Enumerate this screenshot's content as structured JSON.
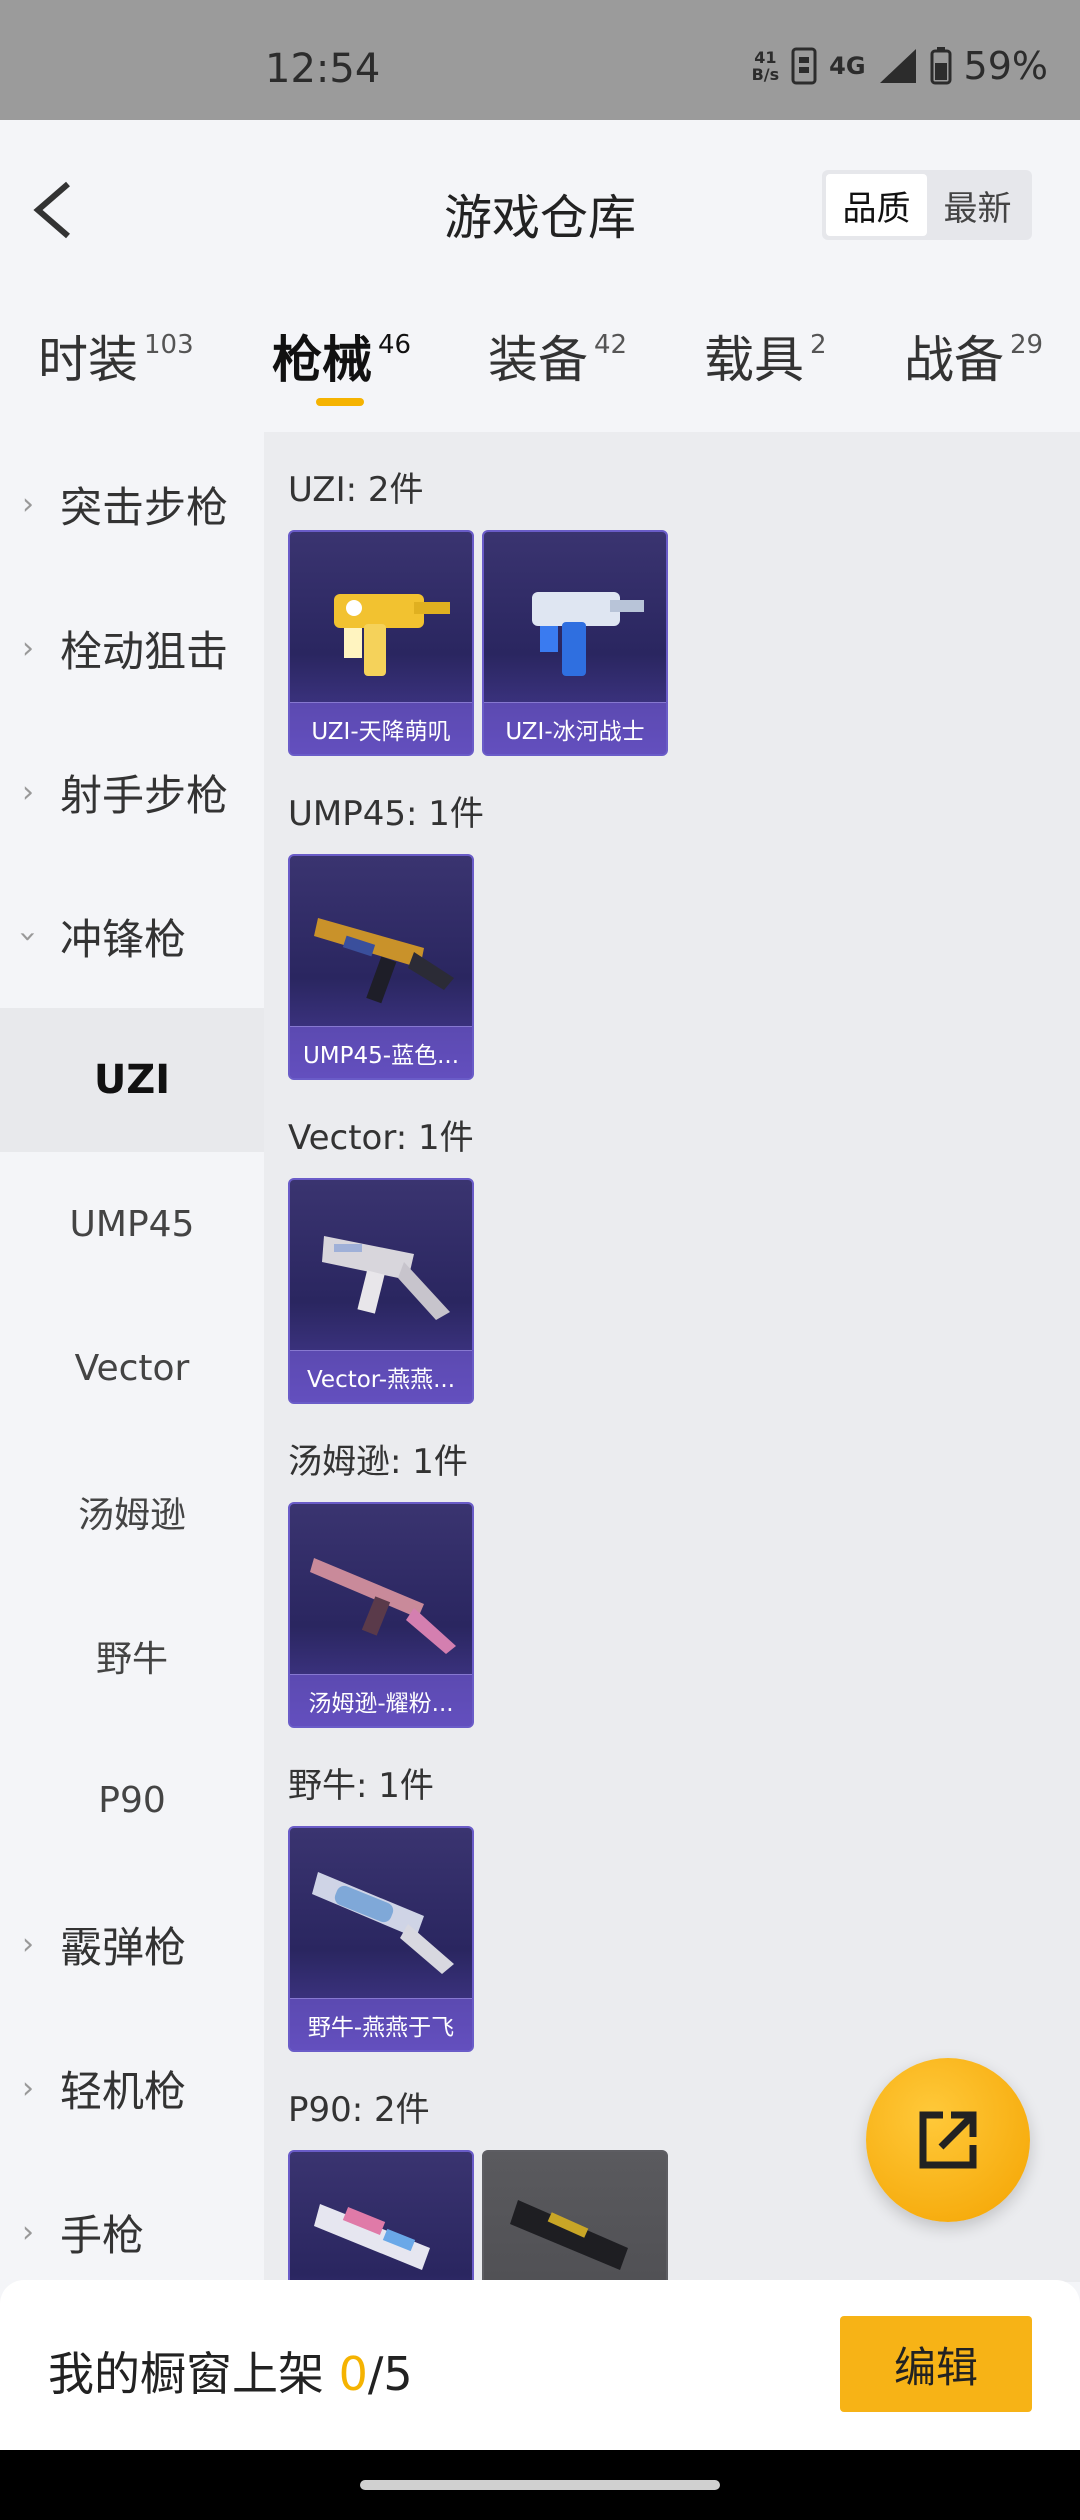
{
  "status_bar": {
    "time": "12:54",
    "net_speed_value": "41",
    "net_speed_unit": "B/s",
    "network": "4G",
    "battery": "59%"
  },
  "header": {
    "title": "游戏仓库",
    "sort_options": [
      "品质",
      "最新"
    ],
    "sort_active": "品质"
  },
  "tabs": [
    {
      "label": "时装",
      "count": "103"
    },
    {
      "label": "枪械",
      "count": "46",
      "active": true
    },
    {
      "label": "装备",
      "count": "42"
    },
    {
      "label": "载具",
      "count": "2"
    },
    {
      "label": "战备",
      "count": "29"
    }
  ],
  "sidebar": {
    "categories": [
      {
        "label": "突击步枪",
        "expanded": false
      },
      {
        "label": "栓动狙击",
        "expanded": false
      },
      {
        "label": "射手步枪",
        "expanded": false
      },
      {
        "label": "冲锋枪",
        "expanded": true
      },
      {
        "label": "霰弹枪",
        "expanded": false
      },
      {
        "label": "轻机枪",
        "expanded": false
      },
      {
        "label": "手枪",
        "expanded": false
      }
    ],
    "sub_items": [
      "UZI",
      "UMP45",
      "Vector",
      "汤姆逊",
      "野牛",
      "P90"
    ],
    "active_sub": "UZI"
  },
  "groups": [
    {
      "title": "UZI: 2件",
      "items": [
        "UZI-天降萌叽",
        "UZI-冰河战士"
      ]
    },
    {
      "title": "UMP45: 1件",
      "items": [
        "UMP45-蓝色..."
      ]
    },
    {
      "title": "Vector: 1件",
      "items": [
        "Vector-燕燕..."
      ]
    },
    {
      "title": "汤姆逊: 1件",
      "items": [
        "汤姆逊-耀粉..."
      ]
    },
    {
      "title": "野牛: 1件",
      "items": [
        "野牛-燕燕于飞"
      ]
    },
    {
      "title": "P90: 2件",
      "items": [
        "",
        ""
      ]
    }
  ],
  "bottom_bar": {
    "label": "我的橱窗上架 ",
    "current": "0",
    "total": "/5",
    "edit_button": "编辑"
  },
  "colors": {
    "accent": "#f7b316",
    "card_purple": "#2a2660"
  }
}
